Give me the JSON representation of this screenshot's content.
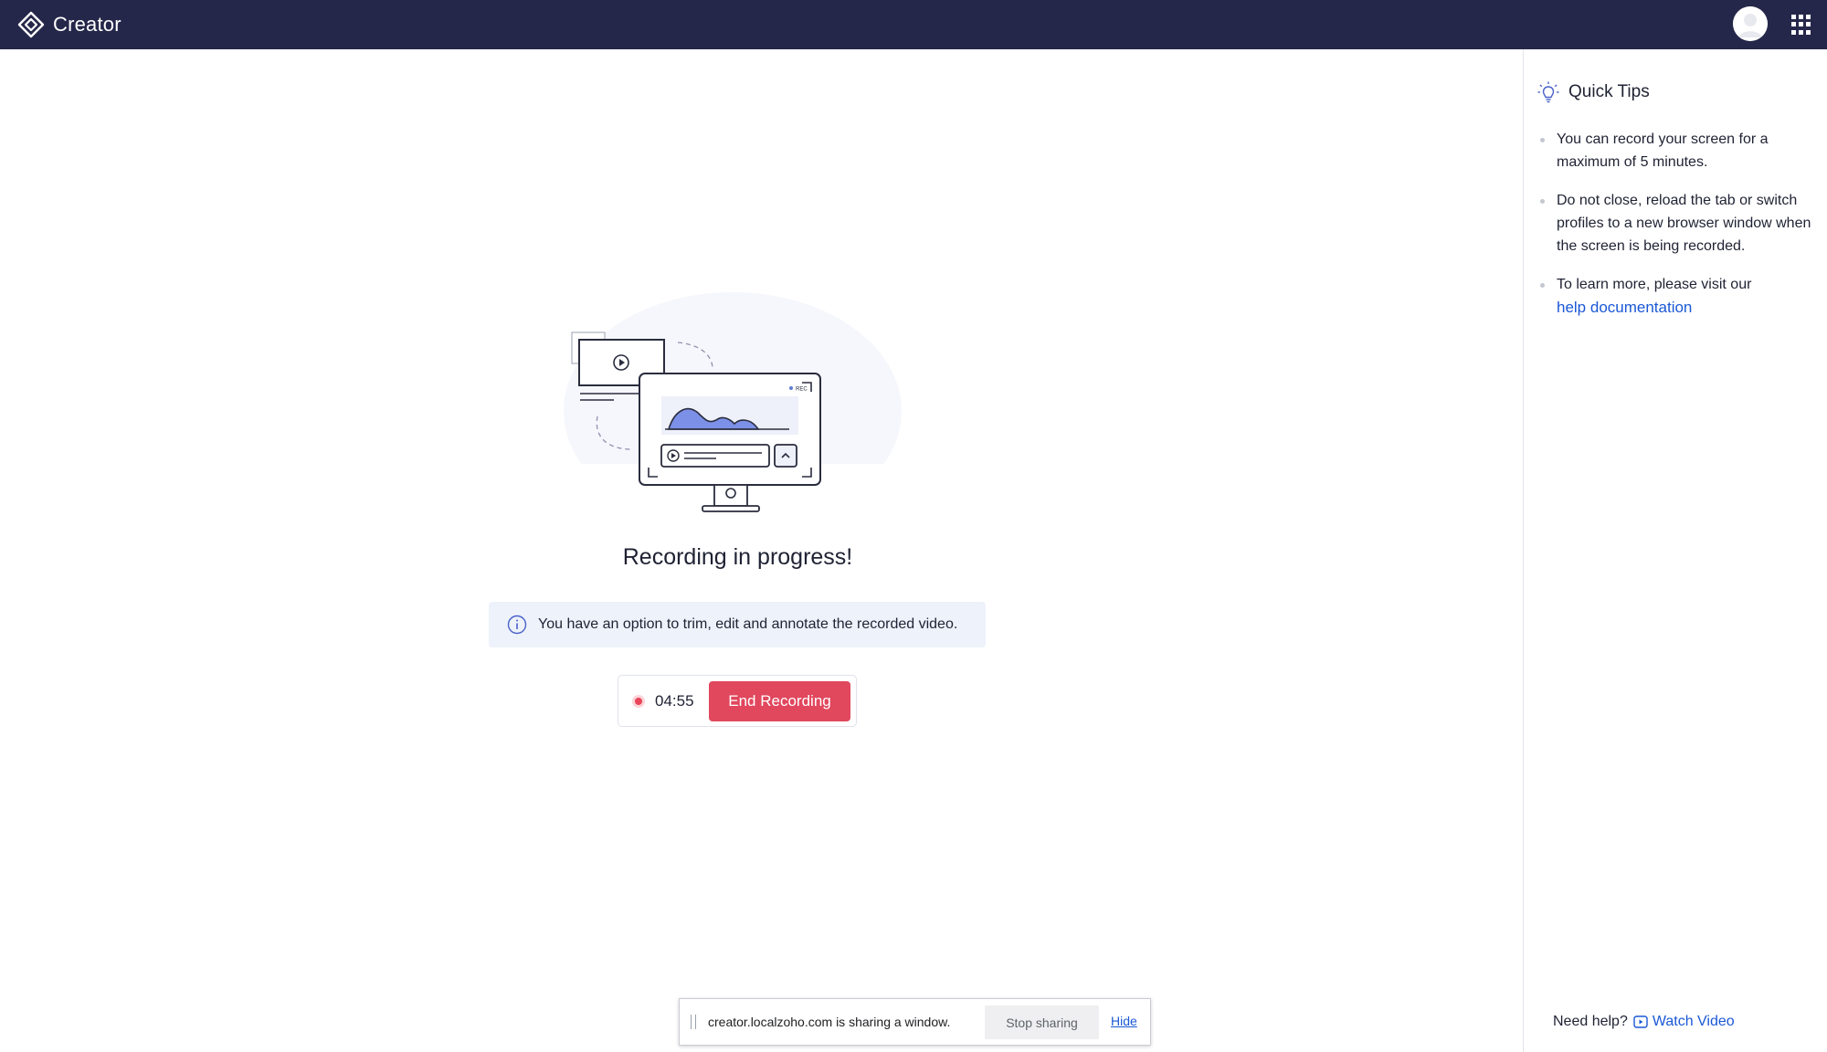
{
  "topbar": {
    "app_title": "Creator",
    "logo_icon": "creator-logo-icon",
    "avatar_icon": "user-avatar",
    "apps_icon": "apps-grid-icon",
    "background": "#25274a"
  },
  "main": {
    "illustration": {
      "icon": "screen-recording-illustration",
      "badge_text": "REC"
    },
    "title": "Recording in progress!",
    "info": {
      "icon": "info-icon",
      "text": "You have an option to trim, edit and annotate the recorded video."
    },
    "recorder": {
      "indicator_icon": "record-dot-icon",
      "timer": "04:55",
      "end_button_label": "End Recording",
      "accent": "#e1475d"
    }
  },
  "share_bar": {
    "text": "creator.localzoho.com is sharing a window.",
    "stop_label": "Stop sharing",
    "hide_label": "Hide"
  },
  "sidebar": {
    "icon": "lightbulb-icon",
    "title": "Quick Tips",
    "tips": [
      "You can record your screen for a maximum of 5 minutes.",
      "Do not close, reload the tab or switch profiles to a new browser window when the screen is being recorded.",
      "To learn more, please visit our"
    ],
    "help_link": "help documentation",
    "need_help": "Need help?",
    "watch_video": "Watch Video",
    "watch_icon": "video-play-icon",
    "link_color": "#1a58d6"
  }
}
